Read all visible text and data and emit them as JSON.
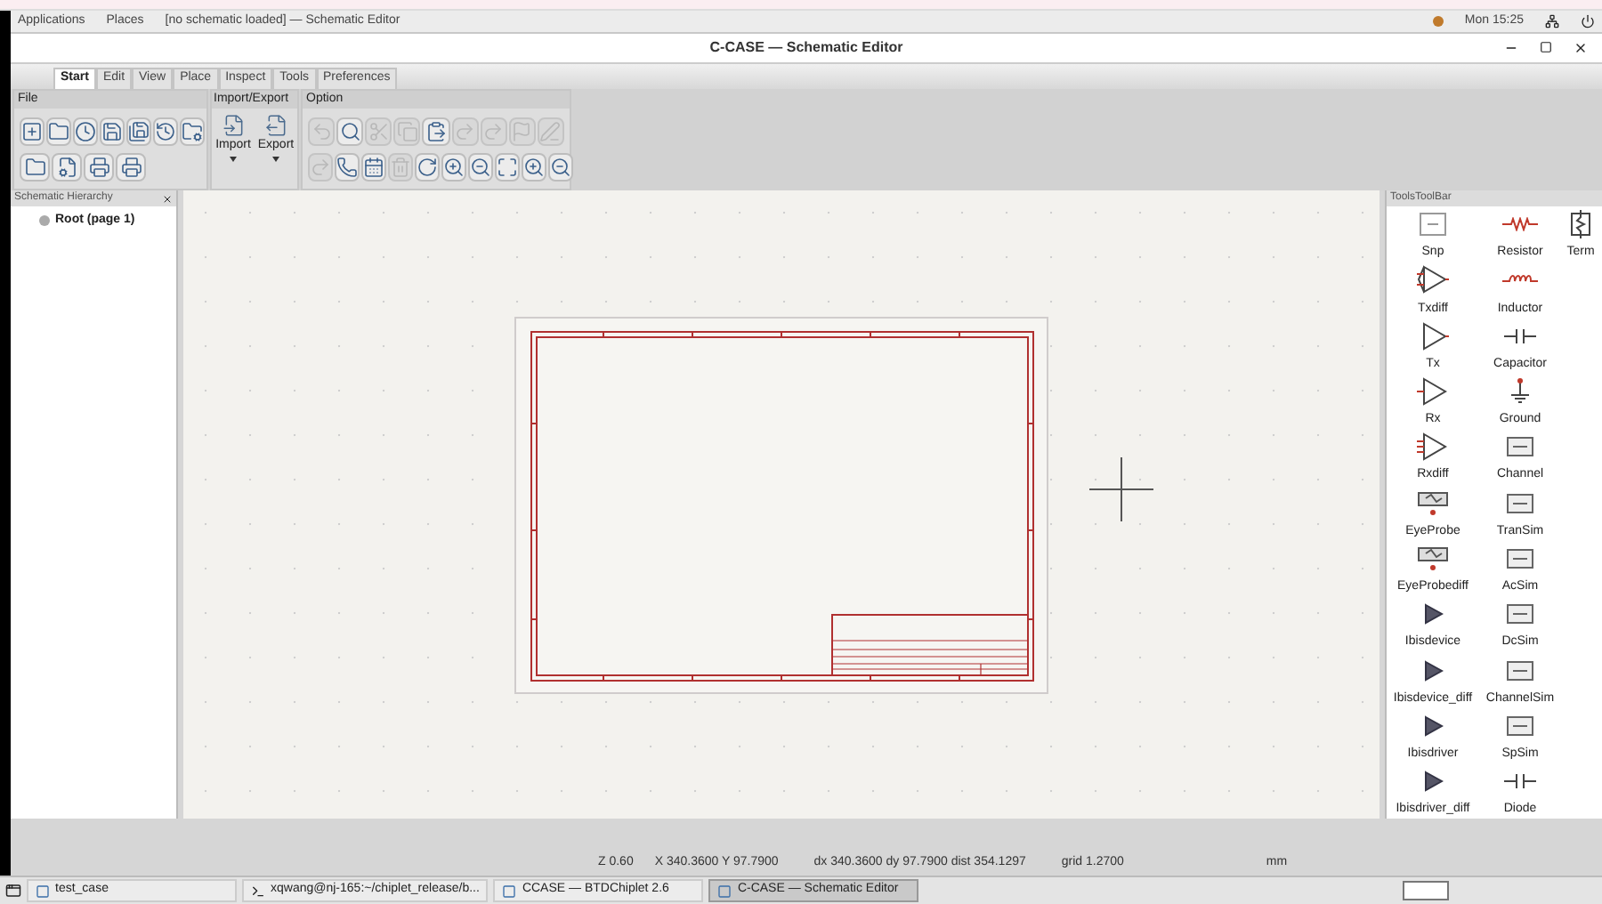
{
  "top_bar": {
    "menus": [
      "Applications",
      "Places"
    ],
    "window_label": "[no schematic loaded] — Schematic  Editor",
    "clock": "Mon 15:25"
  },
  "window": {
    "title": "C-CASE — Schematic Editor"
  },
  "tabs": [
    {
      "label": "Start",
      "selected": true
    },
    {
      "label": "Edit",
      "selected": false
    },
    {
      "label": "View",
      "selected": false
    },
    {
      "label": "Place",
      "selected": false
    },
    {
      "label": "Inspect",
      "selected": false
    },
    {
      "label": "Tools",
      "selected": false
    },
    {
      "label": "Preferences",
      "selected": false
    }
  ],
  "ribbon": {
    "file": {
      "title": "File",
      "rows": [
        [
          {
            "kind": "new",
            "disabled": false
          },
          {
            "kind": "open",
            "disabled": false
          },
          {
            "kind": "recent",
            "disabled": false
          },
          {
            "kind": "save",
            "disabled": false
          },
          {
            "kind": "save-as",
            "disabled": false
          },
          {
            "kind": "revert",
            "disabled": false
          },
          {
            "kind": "folder-gear",
            "disabled": false
          }
        ],
        [
          {
            "kind": "folder",
            "disabled": false
          },
          {
            "kind": "file-gear",
            "disabled": false
          },
          {
            "kind": "print",
            "disabled": false
          },
          {
            "kind": "print",
            "disabled": false
          }
        ]
      ]
    },
    "import_export": {
      "title": "Import/Export",
      "buttons": [
        {
          "label": "Import",
          "kind": "import"
        },
        {
          "label": "Export",
          "kind": "export"
        }
      ]
    },
    "option": {
      "title": "Option",
      "rows": [
        [
          {
            "kind": "undo",
            "disabled": true
          },
          {
            "kind": "search",
            "disabled": false
          },
          {
            "kind": "cut",
            "disabled": true
          },
          {
            "kind": "copy",
            "disabled": true
          },
          {
            "kind": "paste",
            "disabled": false
          },
          {
            "kind": "redo",
            "disabled": true
          },
          {
            "kind": "redo",
            "disabled": true
          },
          {
            "kind": "flag",
            "disabled": true
          },
          {
            "kind": "pen",
            "disabled": true
          }
        ],
        [
          {
            "kind": "redo",
            "disabled": true
          },
          {
            "kind": "phone",
            "disabled": false
          },
          {
            "kind": "calendar",
            "disabled": false
          },
          {
            "kind": "delete",
            "disabled": true
          },
          {
            "kind": "rotate",
            "disabled": false
          },
          {
            "kind": "zoom-in",
            "disabled": false
          },
          {
            "kind": "zoom-out",
            "disabled": false
          },
          {
            "kind": "zoom-fit",
            "disabled": false
          },
          {
            "kind": "zoom-in",
            "disabled": false
          },
          {
            "kind": "zoom-out",
            "disabled": false
          }
        ]
      ]
    }
  },
  "hierarchy": {
    "title": "Schematic Hierarchy",
    "items": [
      {
        "label": "Root (page 1)"
      }
    ]
  },
  "toolbox": {
    "title": "ToolsToolBar",
    "rows": [
      [
        {
          "label": "Snp",
          "kind": "snp"
        },
        {
          "label": "Resistor",
          "kind": "resistor"
        },
        {
          "label": "Term",
          "kind": "term"
        }
      ],
      [
        {
          "label": "Txdiff",
          "kind": "txdiff"
        },
        {
          "label": "Inductor",
          "kind": "inductor"
        }
      ],
      [
        {
          "label": "Tx",
          "kind": "tx"
        },
        {
          "label": "Capacitor",
          "kind": "capacitor"
        }
      ],
      [
        {
          "label": "Rx",
          "kind": "rx"
        },
        {
          "label": "Ground",
          "kind": "ground"
        }
      ],
      [
        {
          "label": "Rxdiff",
          "kind": "rxdiff"
        },
        {
          "label": "Channel",
          "kind": "box"
        }
      ],
      [
        {
          "label": "EyeProbe",
          "kind": "probe"
        },
        {
          "label": "TranSim",
          "kind": "box"
        }
      ],
      [
        {
          "label": "EyeProbediff",
          "kind": "probe"
        },
        {
          "label": "AcSim",
          "kind": "box"
        }
      ],
      [
        {
          "label": "Ibisdevice",
          "kind": "ibis"
        },
        {
          "label": "DcSim",
          "kind": "box"
        }
      ],
      [
        {
          "label": "Ibisdevice_diff",
          "kind": "ibis"
        },
        {
          "label": "ChannelSim",
          "kind": "box"
        }
      ],
      [
        {
          "label": "Ibisdriver",
          "kind": "ibis"
        },
        {
          "label": "SpSim",
          "kind": "box"
        }
      ],
      [
        {
          "label": "Ibisdriver_diff",
          "kind": "ibis"
        },
        {
          "label": "Diode",
          "kind": "capacitor"
        }
      ]
    ]
  },
  "status_bar": [
    "Z 0.60",
    "X 340.3600  Y 97.7900",
    "dx 340.3600  dy 97.7900  dist 354.1297",
    "grid 1.2700",
    "mm"
  ],
  "taskbar": [
    {
      "label": "test_case",
      "selected": false
    },
    {
      "label": "xqwang@nj-165:~/chiplet_release/b...",
      "selected": false
    },
    {
      "label": "CCASE — BTDChiplet 2.6",
      "selected": false
    },
    {
      "label": "C-CASE — Schematic  Editor",
      "selected": true
    }
  ]
}
